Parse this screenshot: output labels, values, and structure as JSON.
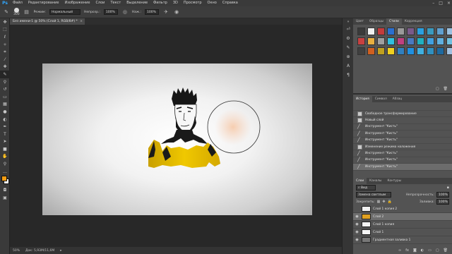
{
  "app": {
    "logo": "Ps"
  },
  "menu": [
    "Файл",
    "Редактирование",
    "Изображение",
    "Слои",
    "Текст",
    "Выделение",
    "Фильтр",
    "3D",
    "Просмотр",
    "Окно",
    "Справка"
  ],
  "window_controls": [
    "–",
    "□",
    "×"
  ],
  "options": {
    "brush_size": "300",
    "mode_label": "Режим:",
    "mode_value": "Нормальный",
    "opacity_label": "Непрозр.:",
    "opacity_value": "100%",
    "flow_label": "Наж.:",
    "flow_value": "100%"
  },
  "document": {
    "tab_title": "Без имени-1 @ 50% (Слой 1, RGB/8#) *",
    "tab_close": "×"
  },
  "status": {
    "zoom": "50%",
    "doc_info": "Док: 5,93M/11,6M"
  },
  "color_panel": {
    "tabs": [
      "Цвет",
      "Образцы",
      "Стили",
      "Коррекция"
    ],
    "active_tab": 2,
    "swatches": [
      "#3a3a3a",
      "#f0f0f0",
      "#c43c3c",
      "#2a6fd0",
      "#9a9a9a",
      "#7a5a8a",
      "#2aa0e0",
      "#3a9ac0",
      "#60a0d0",
      "#9ac0e0",
      "#c84040",
      "#e8b040",
      "#a0a0a0",
      "#30c0e0",
      "#c04080",
      "#4a7ac0",
      "#20b0c0",
      "#40a0e0",
      "#60b0e0",
      "#70c0e0",
      "#404040",
      "#d06020",
      "#c0a020",
      "#f0d020",
      "#3080c0",
      "#2090e0",
      "#40b0e0",
      "#3090c0",
      "#1e6aa0",
      "#a0c0e0"
    ]
  },
  "history_panel": {
    "tabs": [
      "История",
      "Символ",
      "Абзац"
    ],
    "active_tab": 0,
    "items": [
      {
        "label": "Свободное трансформирование",
        "icon": "thumb"
      },
      {
        "label": "Новый слой",
        "icon": "thumb"
      },
      {
        "label": "Инструмент \"Кисть\"",
        "icon": "brush"
      },
      {
        "label": "Инструмент \"Кисть\"",
        "icon": "brush"
      },
      {
        "label": "Инструмент \"Кисть\"",
        "icon": "brush"
      },
      {
        "label": "Изменение режима наложения",
        "icon": "thumb"
      },
      {
        "label": "Инструмент \"Кисть\"",
        "icon": "brush"
      },
      {
        "label": "Инструмент \"Кисть\"",
        "icon": "brush"
      },
      {
        "label": "Инструмент \"Кисть\"",
        "icon": "brush"
      }
    ],
    "selected_index": 8
  },
  "layers_panel": {
    "tabs": [
      "Слои",
      "Каналы",
      "Контуры"
    ],
    "active_tab": 0,
    "filter_label": "Вид",
    "blend_mode": "Замена светлым",
    "opacity_label": "Непрозрачность:",
    "opacity_value": "100%",
    "lock_label": "Закрепить:",
    "fill_label": "Заливка:",
    "fill_value": "100%",
    "layers": [
      {
        "name": "Слой 1 копия 2",
        "thumb": "#f2f2f2",
        "visible": false
      },
      {
        "name": "Слой 2",
        "thumb": "#e0a020",
        "visible": true
      },
      {
        "name": "Слой 1 копия",
        "thumb": "#f4f4f4",
        "visible": true
      },
      {
        "name": "Слой 1",
        "thumb": "#f6f6f6",
        "visible": true
      },
      {
        "name": "Градиентная заливка 1",
        "thumb": "#777777",
        "visible": true
      }
    ],
    "selected_index": 1
  },
  "colors": {
    "foreground": "#f39c12",
    "background": "#ffffff",
    "accent": "#31a8ff"
  }
}
